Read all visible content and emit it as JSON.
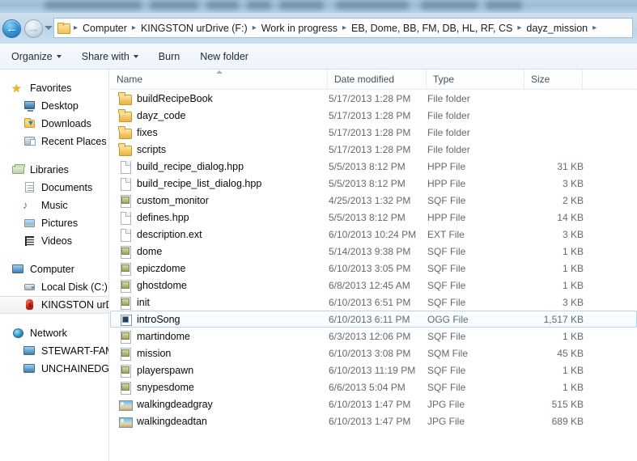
{
  "window": {
    "nav": {
      "back_icon": "back-arrow-icon",
      "forward_icon": "forward-arrow-icon",
      "recent_pages_icon": "chevron-down-icon",
      "folder_icon": "folder-icon",
      "separator": "▸"
    },
    "breadcrumb": [
      "Computer",
      "KINGSTON urDrive (F:)",
      "Work in progress",
      "EB, Dome, BB, FM, DB, HL, RF, CS",
      "dayz_mission"
    ]
  },
  "command_bar": {
    "items": [
      {
        "label": "Organize",
        "has_caret": true
      },
      {
        "label": "Share with",
        "has_caret": true
      },
      {
        "label": "Burn",
        "has_caret": false
      },
      {
        "label": "New folder",
        "has_caret": false
      }
    ]
  },
  "sidebar": {
    "groups": [
      {
        "header": {
          "label": "Favorites",
          "icon": "star-icon"
        },
        "items": [
          {
            "label": "Desktop",
            "icon": "desktop-monitor-icon"
          },
          {
            "label": "Downloads",
            "icon": "downloads-folder-icon"
          },
          {
            "label": "Recent Places",
            "icon": "recent-places-icon"
          }
        ]
      },
      {
        "header": {
          "label": "Libraries",
          "icon": "libraries-icon"
        },
        "items": [
          {
            "label": "Documents",
            "icon": "documents-icon"
          },
          {
            "label": "Music",
            "icon": "music-note-icon"
          },
          {
            "label": "Pictures",
            "icon": "pictures-icon"
          },
          {
            "label": "Videos",
            "icon": "videos-filmstrip-icon"
          }
        ]
      },
      {
        "header": {
          "label": "Computer",
          "icon": "computer-icon"
        },
        "items": [
          {
            "label": "Local Disk (C:)",
            "icon": "hard-disk-icon",
            "selected": false
          },
          {
            "label": "KINGSTON urDri",
            "icon": "usb-drive-icon",
            "selected": true
          }
        ]
      },
      {
        "header": {
          "label": "Network",
          "icon": "network-globe-icon"
        },
        "items": [
          {
            "label": "STEWART-FAMI",
            "icon": "network-computer-icon"
          },
          {
            "label": "UNCHAINEDGUI",
            "icon": "network-computer-icon"
          }
        ]
      }
    ]
  },
  "file_list": {
    "columns": [
      {
        "key": "name",
        "label": "Name",
        "sorted": true,
        "sort_direction": "ascending"
      },
      {
        "key": "date",
        "label": "Date modified"
      },
      {
        "key": "type",
        "label": "Type"
      },
      {
        "key": "size",
        "label": "Size"
      }
    ],
    "rows": [
      {
        "name": "buildRecipeBook",
        "date": "5/17/2013 1:28 PM",
        "type": "File folder",
        "size": "",
        "icon": "folder-icon",
        "state": "normal"
      },
      {
        "name": "dayz_code",
        "date": "5/17/2013 1:28 PM",
        "type": "File folder",
        "size": "",
        "icon": "folder-icon",
        "state": "normal"
      },
      {
        "name": "fixes",
        "date": "5/17/2013 1:28 PM",
        "type": "File folder",
        "size": "",
        "icon": "folder-icon",
        "state": "normal"
      },
      {
        "name": "scripts",
        "date": "5/17/2013 1:28 PM",
        "type": "File folder",
        "size": "",
        "icon": "folder-icon",
        "state": "normal"
      },
      {
        "name": "build_recipe_dialog.hpp",
        "date": "5/5/2013 8:12 PM",
        "type": "HPP File",
        "size": "31 KB",
        "icon": "document-icon",
        "state": "normal"
      },
      {
        "name": "build_recipe_list_dialog.hpp",
        "date": "5/5/2013 8:12 PM",
        "type": "HPP File",
        "size": "3 KB",
        "icon": "document-icon",
        "state": "normal"
      },
      {
        "name": "custom_monitor",
        "date": "4/25/2013 1:32 PM",
        "type": "SQF File",
        "size": "2 KB",
        "icon": "sqf-file-icon",
        "state": "normal"
      },
      {
        "name": "defines.hpp",
        "date": "5/5/2013 8:12 PM",
        "type": "HPP File",
        "size": "14 KB",
        "icon": "document-icon",
        "state": "normal"
      },
      {
        "name": "description.ext",
        "date": "6/10/2013 10:24 PM",
        "type": "EXT File",
        "size": "3 KB",
        "icon": "document-icon",
        "state": "normal"
      },
      {
        "name": "dome",
        "date": "5/14/2013 9:38 PM",
        "type": "SQF File",
        "size": "1 KB",
        "icon": "sqf-file-icon",
        "state": "normal"
      },
      {
        "name": "epiczdome",
        "date": "6/10/2013 3:05 PM",
        "type": "SQF File",
        "size": "1 KB",
        "icon": "sqf-file-icon",
        "state": "normal"
      },
      {
        "name": "ghostdome",
        "date": "6/8/2013 12:45 AM",
        "type": "SQF File",
        "size": "1 KB",
        "icon": "sqf-file-icon",
        "state": "normal"
      },
      {
        "name": "init",
        "date": "6/10/2013 6:51 PM",
        "type": "SQF File",
        "size": "3 KB",
        "icon": "sqf-file-icon",
        "state": "normal"
      },
      {
        "name": "introSong",
        "date": "6/10/2013 6:11 PM",
        "type": "OGG File",
        "size": "1,517 KB",
        "icon": "ogg-audio-icon",
        "state": "hovered"
      },
      {
        "name": "martindome",
        "date": "6/3/2013 12:06 PM",
        "type": "SQF File",
        "size": "1 KB",
        "icon": "sqf-file-icon",
        "state": "normal"
      },
      {
        "name": "mission",
        "date": "6/10/2013 3:08 PM",
        "type": "SQM File",
        "size": "45 KB",
        "icon": "sqf-file-icon",
        "state": "normal"
      },
      {
        "name": "playerspawn",
        "date": "6/10/2013 11:19 PM",
        "type": "SQF File",
        "size": "1 KB",
        "icon": "sqf-file-icon",
        "state": "normal"
      },
      {
        "name": "snypesdome",
        "date": "6/6/2013 5:04 PM",
        "type": "SQF File",
        "size": "1 KB",
        "icon": "sqf-file-icon",
        "state": "normal"
      },
      {
        "name": "walkingdeadgray",
        "date": "6/10/2013 1:47 PM",
        "type": "JPG File",
        "size": "515 KB",
        "icon": "jpg-image-icon",
        "state": "normal"
      },
      {
        "name": "walkingdeadtan",
        "date": "6/10/2013 1:47 PM",
        "type": "JPG File",
        "size": "689 KB",
        "icon": "jpg-image-icon",
        "state": "normal"
      }
    ]
  },
  "colors": {
    "chrome_blue": "#c3d8ea",
    "selection_border": "#b6d4ea",
    "text_primary": "#0a0a0a",
    "text_secondary": "#5f6b73",
    "folder_yellow": "#f3c662",
    "usb_red": "#d01f10"
  }
}
